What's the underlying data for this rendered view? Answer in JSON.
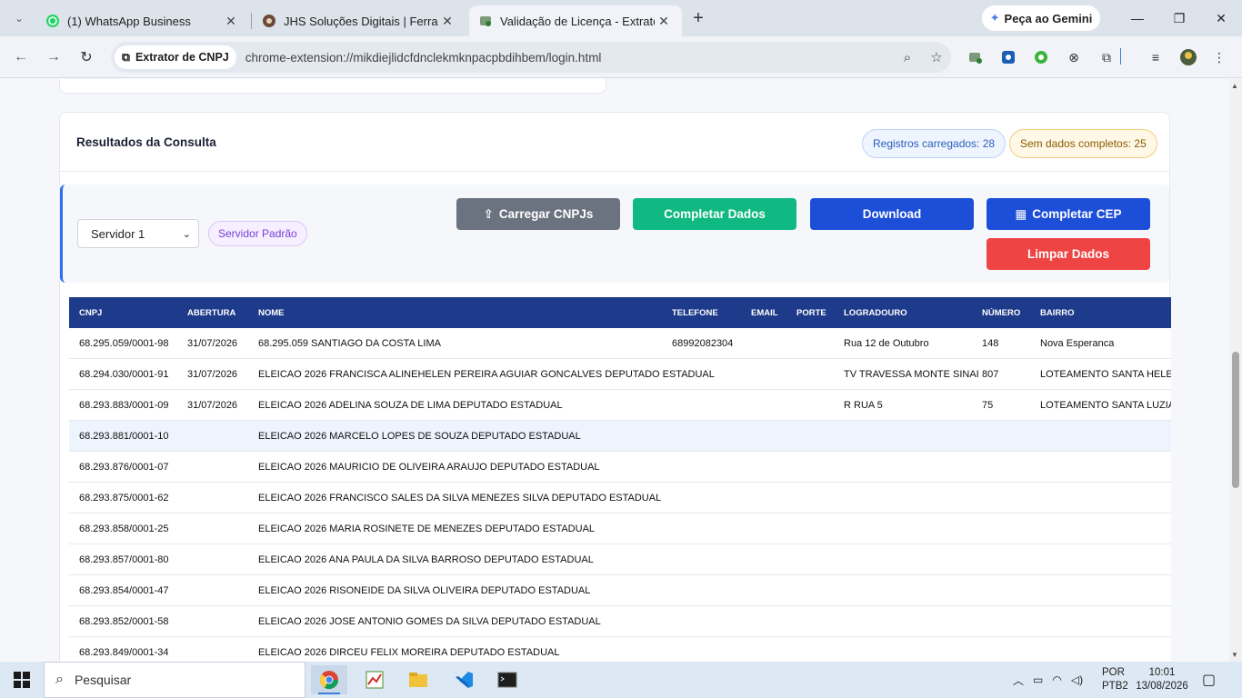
{
  "browser": {
    "tabs": [
      {
        "title": "(1) WhatsApp Business",
        "icon": "whatsapp-icon"
      },
      {
        "title": "JHS Soluções Digitais | Ferrame",
        "icon": "jhs-icon"
      },
      {
        "title": "Validação de Licença - Extrator",
        "icon": "extension-icon"
      }
    ],
    "gemini_label": "Peça ao Gemini",
    "chip_label": "Extrator de CNPJ",
    "url": "chrome-extension://mikdiejlidcfdnclekmknpacpbdihbem/login.html"
  },
  "results": {
    "title": "Resultados da Consulta",
    "badge_loaded": "Registros carregados: 28",
    "badge_incomplete": "Sem dados completos: 25"
  },
  "controls": {
    "server_select": "Servidor 1",
    "server_pill": "Servidor Padrão",
    "btn_upload": "Carregar CNPJs",
    "btn_complete": "Completar Dados",
    "btn_download": "Download",
    "btn_cep": "Completar CEP",
    "btn_clear": "Limpar Dados"
  },
  "table": {
    "headers": [
      "CNPJ",
      "ABERTURA",
      "NOME",
      "TELEFONE",
      "EMAIL",
      "PORTE",
      "LOGRADOURO",
      "NÚMERO",
      "BAIRRO"
    ],
    "rows": [
      [
        "68.295.059/0001-98",
        "31/07/2026",
        "68.295.059 SANTIAGO DA COSTA LIMA",
        "68992082304",
        "",
        "",
        "Rua 12 de Outubro",
        "148",
        "Nova Esperanca"
      ],
      [
        "68.294.030/0001-91",
        "31/07/2026",
        "ELEICAO 2026 FRANCISCA ALINEHELEN PEREIRA AGUIAR GONCALVES DEPUTADO ESTADUAL",
        "",
        "",
        "",
        "TV TRAVESSA MONTE SINAI",
        "807",
        "LOTEAMENTO SANTA HELENA"
      ],
      [
        "68.293.883/0001-09",
        "31/07/2026",
        "ELEICAO 2026 ADELINA SOUZA DE LIMA DEPUTADO ESTADUAL",
        "",
        "",
        "",
        "R RUA 5",
        "75",
        "LOTEAMENTO SANTA LUZIA"
      ],
      [
        "68.293.881/0001-10",
        "",
        "ELEICAO 2026 MARCELO LOPES DE SOUZA DEPUTADO ESTADUAL",
        "",
        "",
        "",
        "",
        "",
        ""
      ],
      [
        "68.293.876/0001-07",
        "",
        "ELEICAO 2026 MAURICIO DE OLIVEIRA ARAUJO DEPUTADO ESTADUAL",
        "",
        "",
        "",
        "",
        "",
        ""
      ],
      [
        "68.293.875/0001-62",
        "",
        "ELEICAO 2026 FRANCISCO SALES DA SILVA MENEZES SILVA DEPUTADO ESTADUAL",
        "",
        "",
        "",
        "",
        "",
        ""
      ],
      [
        "68.293.858/0001-25",
        "",
        "ELEICAO 2026 MARIA ROSINETE DE MENEZES DEPUTADO ESTADUAL",
        "",
        "",
        "",
        "",
        "",
        ""
      ],
      [
        "68.293.857/0001-80",
        "",
        "ELEICAO 2026 ANA PAULA DA SILVA BARROSO DEPUTADO ESTADUAL",
        "",
        "",
        "",
        "",
        "",
        ""
      ],
      [
        "68.293.854/0001-47",
        "",
        "ELEICAO 2026 RISONEIDE DA SILVA OLIVEIRA DEPUTADO ESTADUAL",
        "",
        "",
        "",
        "",
        "",
        ""
      ],
      [
        "68.293.852/0001-58",
        "",
        "ELEICAO 2026 JOSE ANTONIO GOMES DA SILVA DEPUTADO ESTADUAL",
        "",
        "",
        "",
        "",
        "",
        ""
      ],
      [
        "68.293.849/0001-34",
        "",
        "ELEICAO 2026 DIRCEU FELIX MOREIRA DEPUTADO ESTADUAL",
        "",
        "",
        "",
        "",
        "",
        ""
      ]
    ]
  },
  "taskbar": {
    "search_placeholder": "Pesquisar",
    "lang1": "POR",
    "lang2": "PTB2",
    "time": "10:01",
    "date": "13/08/2026"
  }
}
